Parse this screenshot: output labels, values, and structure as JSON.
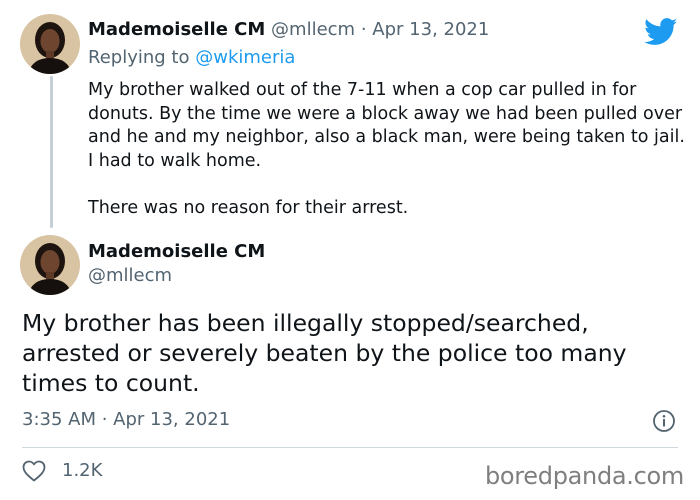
{
  "reply_tweet": {
    "name": "Mademoiselle CM",
    "handle": "@mllecm",
    "separator": "·",
    "date": "Apr 13, 2021",
    "replying_prefix": "Replying to",
    "replying_handle": "@wkimeria",
    "paragraphs": [
      "My brother walked out of the 7-11 when a cop car pulled in for donuts.  By the time we were a block away we had been pulled over and he and my neighbor, also a black man, were being taken to jail.  I had to walk home.",
      "There was no reason for their arrest."
    ]
  },
  "main_tweet": {
    "name": "Mademoiselle CM",
    "handle": "@mllecm",
    "text": "My brother has been illegally stopped/searched, arrested or severely beaten by the police too many times to count.",
    "timestamp": "3:35 AM · Apr 13, 2021",
    "likes": "1.2K"
  },
  "icons": {
    "brand": "twitter-bird-icon",
    "info": "info-icon",
    "like": "heart-icon"
  },
  "colors": {
    "brand_blue": "#1d9bf0",
    "muted_text": "#536471",
    "thread_line": "#c4cfd6"
  },
  "watermark": "boredpanda.com"
}
